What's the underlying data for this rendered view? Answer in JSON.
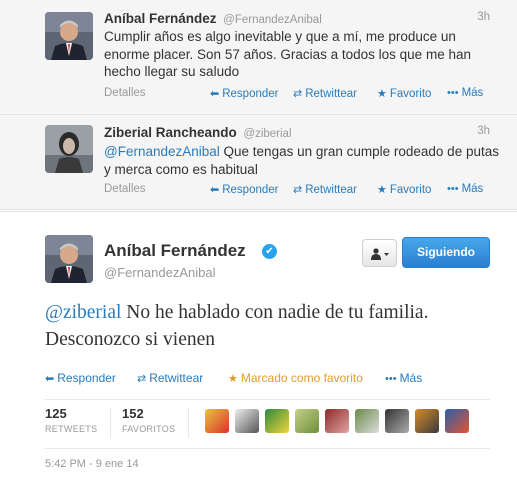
{
  "tweet1": {
    "name": "Aníbal Fernández",
    "handle": "@FernandezAnibal",
    "time": "3h",
    "text": "Cumplir años es algo inevitable y que a mí, me produce un enorme placer. Son 57 años. Gracias a todos los que me han hecho llegar su saludo",
    "actions": {
      "details": "Detalles",
      "reply": "Responder",
      "retweet": "Retwittear",
      "favorite": "Favorito",
      "more": "Más"
    }
  },
  "tweet2": {
    "name": "Ziberial Rancheando",
    "handle": "@ziberial",
    "time": "3h",
    "mention": "@FernandezAnibal",
    "text": " Que tengas un gran cumple rodeado de putas y merca como es habitual",
    "actions": {
      "details": "Detalles",
      "reply": "Responder",
      "retweet": "Retwittear",
      "favorite": "Favorito",
      "more": "Más"
    }
  },
  "main_tweet": {
    "name": "Aníbal Fernández",
    "handle": "@FernandezAnibal",
    "verified_icon": "✔",
    "user_menu_icon": "person-dropdown-icon",
    "follow_label": "Siguiendo",
    "mention": "@ziberial",
    "text": " No he hablado con nadie de tu familia. Desconozco si vienen",
    "actions": {
      "reply": "Responder",
      "retweet": "Retwittear",
      "favorited": "Marcado como favorito",
      "more": "Más"
    },
    "stats": {
      "retweets_count": "125",
      "retweets_label": "RETWEETS",
      "favorites_count": "152",
      "favorites_label": "FAVORITOS"
    },
    "favoriters_count": 9,
    "date": "5:42 PM - 9 ene 14"
  },
  "colors": {
    "link": "#2a7bba",
    "favorite_active": "#e19d2b",
    "follow_button": "#2b7ecf",
    "verified": "#2aa3ef"
  }
}
